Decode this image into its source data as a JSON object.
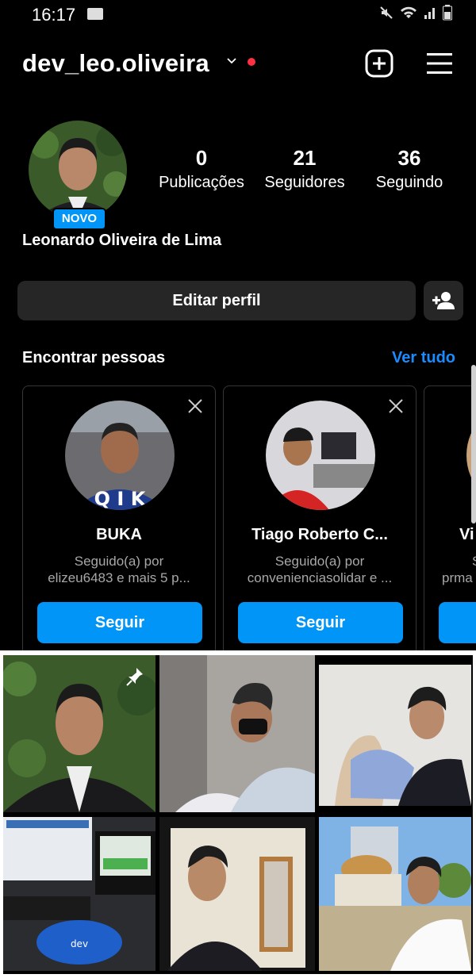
{
  "status_bar": {
    "time": "16:17"
  },
  "header": {
    "username": "dev_leo.oliveira"
  },
  "profile": {
    "badge": "NOVO",
    "full_name": "Leonardo Oliveira de Lima",
    "stats": [
      {
        "value": "0",
        "label": "Publicações"
      },
      {
        "value": "21",
        "label": "Seguidores"
      },
      {
        "value": "36",
        "label": "Seguindo"
      }
    ],
    "edit_button": "Editar perfil"
  },
  "suggestions": {
    "title": "Encontrar pessoas",
    "see_all": "Ver tudo",
    "cards": [
      {
        "name": "BUKA",
        "line1": "Seguido(a) por",
        "line2": "elizeu6483 e mais 5 p...",
        "button": "Seguir"
      },
      {
        "name": "Tiago Roberto C...",
        "line1": "Seguido(a) por",
        "line2": "convenienciasolidar e ...",
        "button": "Seguir"
      },
      {
        "name": "Vi",
        "line1": "S",
        "line2": "prma",
        "button": ""
      }
    ]
  },
  "colors": {
    "accent": "#0095f6",
    "link": "#1a8cff",
    "notification": "#ff3040",
    "button_bg": "#262626"
  }
}
